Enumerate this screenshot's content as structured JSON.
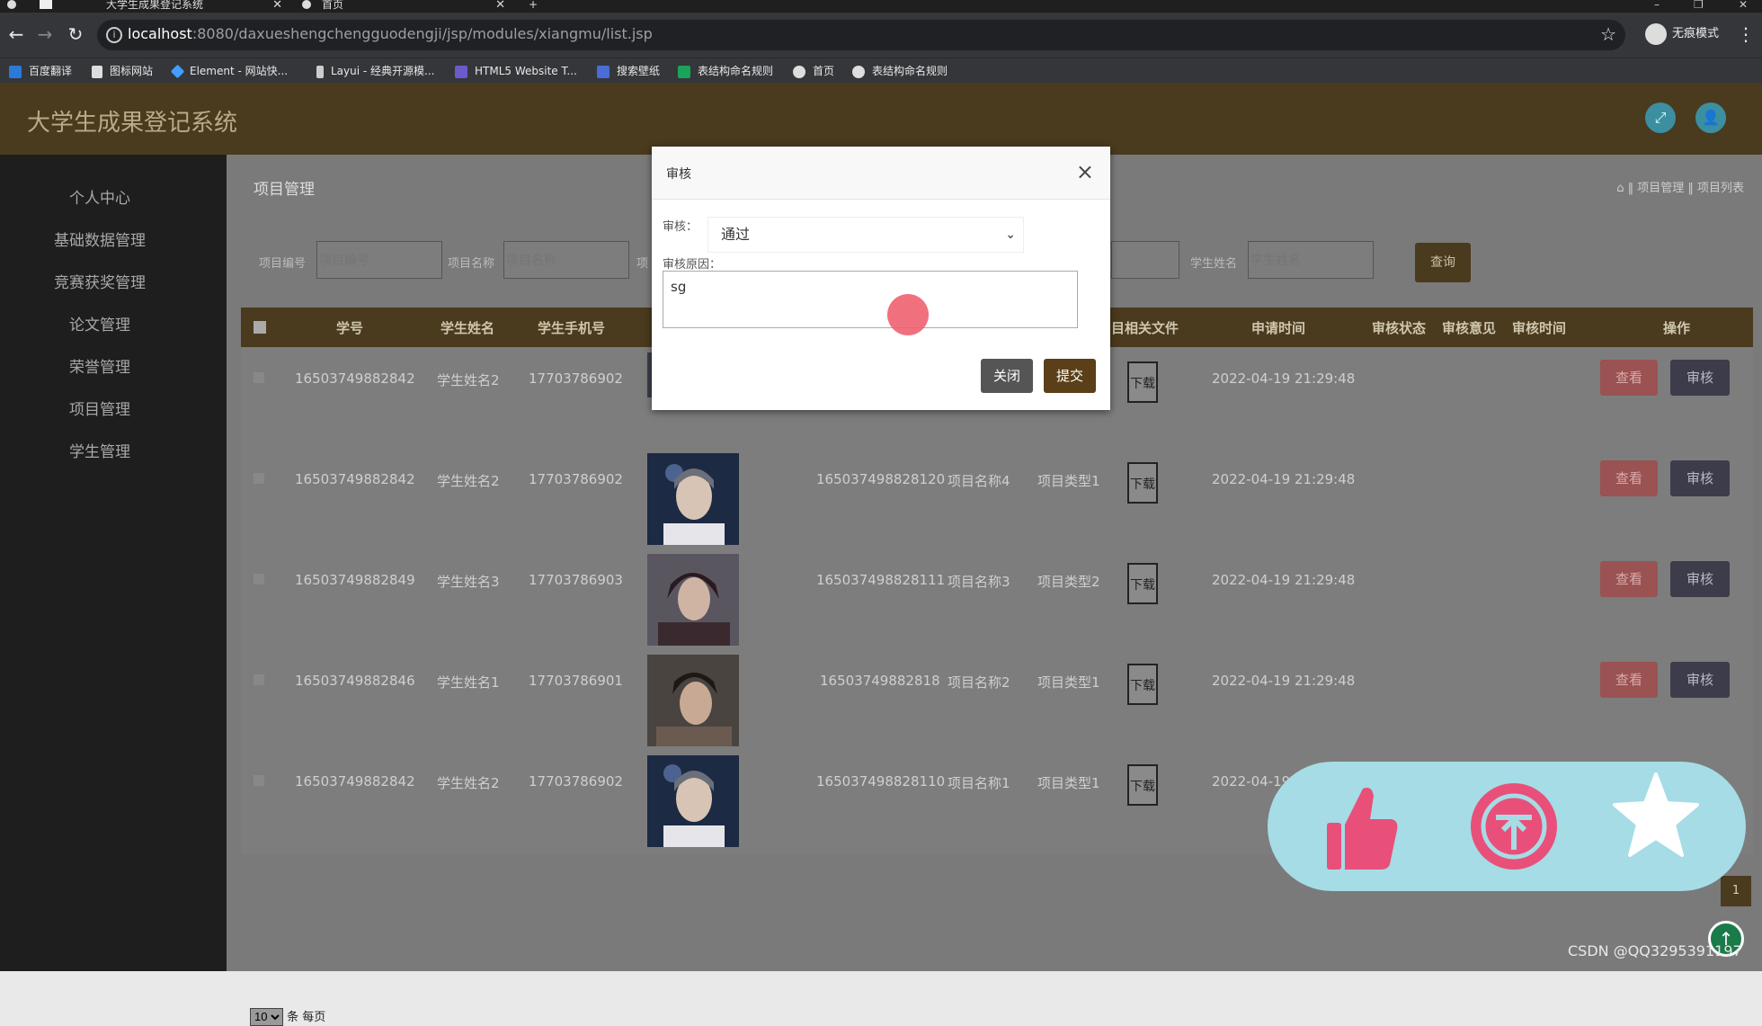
{
  "browser": {
    "tabs": [
      {
        "title": "大学生成果登记系统"
      },
      {
        "title": "首页"
      }
    ],
    "url_host": "localhost",
    "url_path": ":8080/daxueshengchengguodengji/jsp/modules/xiangmu/list.jsp",
    "incognito_label": "无痕模式",
    "bookmarks": [
      "百度翻译",
      "图标网站",
      "Element - 网站快...",
      "Layui - 经典开源模...",
      "HTML5 Website T...",
      "搜索壁纸",
      "表结构命名规则",
      "首页",
      "表结构命名规则"
    ]
  },
  "app": {
    "title": "大学生成果登记系统",
    "sidebar": [
      "个人中心",
      "基础数据管理",
      "竞赛获奖管理",
      "论文管理",
      "荣誉管理",
      "项目管理",
      "学生管理"
    ]
  },
  "page": {
    "title": "项目管理",
    "breadcrumb": "⌂ ‖ 项目管理 ‖ 项目列表",
    "filters": {
      "code_label": "项目编号",
      "code_placeholder": "项目编号",
      "name_label": "项目名称",
      "name_placeholder": "项目名称",
      "type_label_partial": "项",
      "student_label": "学生姓名",
      "student_placeholder": "学生姓名",
      "query_button": "查询"
    }
  },
  "table": {
    "headers": [
      "学号",
      "学生姓名",
      "学生手机号",
      "目相关文件",
      "申请时间",
      "审核状态",
      "审核意见",
      "审核时间",
      "操作"
    ],
    "rows": [
      {
        "sid": "16503749882842",
        "name": "学生姓名2",
        "phone": "17703786902",
        "code": "",
        "pname": "",
        "ptype": "",
        "file": "下载",
        "time": "2022-04-19 21:29:48",
        "view": "查看",
        "audit": "审核"
      },
      {
        "sid": "16503749882842",
        "name": "学生姓名2",
        "phone": "17703786902",
        "code": "165037498828120",
        "pname": "项目名称4",
        "ptype": "项目类型1",
        "file": "下载",
        "time": "2022-04-19 21:29:48",
        "view": "查看",
        "audit": "审核"
      },
      {
        "sid": "16503749882849",
        "name": "学生姓名3",
        "phone": "17703786903",
        "code": "165037498828111",
        "pname": "项目名称3",
        "ptype": "项目类型2",
        "file": "下载",
        "time": "2022-04-19 21:29:48",
        "view": "查看",
        "audit": "审核"
      },
      {
        "sid": "16503749882846",
        "name": "学生姓名1",
        "phone": "17703786901",
        "code": "16503749882818",
        "pname": "项目名称2",
        "ptype": "项目类型1",
        "file": "下载",
        "time": "2022-04-19 21:29:48",
        "view": "查看",
        "audit": "审核"
      },
      {
        "sid": "16503749882842",
        "name": "学生姓名2",
        "phone": "17703786902",
        "code": "165037498828110",
        "pname": "项目名称1",
        "ptype": "项目类型1",
        "file": "下载",
        "time": "2022-04-19",
        "view": "",
        "audit": ""
      }
    ],
    "page_size": "10",
    "page_size_suffix": "条 每页",
    "current_page": "1"
  },
  "modal": {
    "title": "审核",
    "audit_label": "审核：",
    "audit_value": "通过",
    "reason_label": "审核原因：",
    "reason_value": "sg",
    "close_button": "关闭",
    "submit_button": "提交"
  },
  "watermark": "CSDN @QQ3295391197",
  "colors": {
    "header": "#4a3a1e",
    "sidebar": "#1e1e1e",
    "overlay_panel": "#a5dce6",
    "accent_pink": "#e8507a"
  }
}
